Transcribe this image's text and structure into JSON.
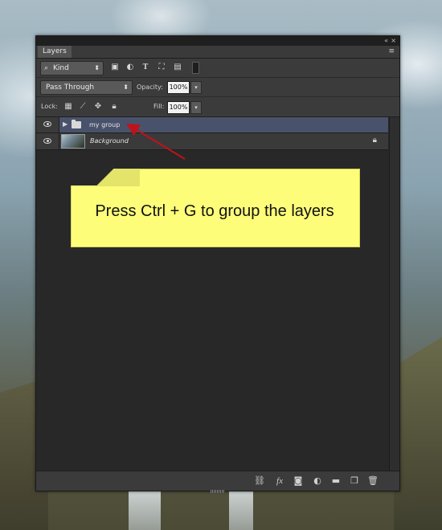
{
  "panel": {
    "title_tab": "Layers",
    "title_controls": {
      "collapse": "«",
      "close": "×"
    },
    "menu_icon": "≡"
  },
  "filter": {
    "kind_label": "Kind",
    "search_icon": "search-icon",
    "icons": [
      "image-filter-icon",
      "adjustment-filter-icon",
      "type-filter-icon",
      "shape-filter-icon",
      "smart-object-filter-icon",
      "filter-toggle-icon"
    ]
  },
  "blend": {
    "mode": "Pass Through",
    "opacity_label": "Opacity:",
    "opacity_value": "100%"
  },
  "lock": {
    "label": "Lock:",
    "icons": [
      "lock-transparent-icon",
      "lock-image-icon",
      "lock-position-icon",
      "lock-all-icon"
    ],
    "fill_label": "Fill:",
    "fill_value": "100%"
  },
  "layers": [
    {
      "name": "my group",
      "type": "group",
      "visible": true,
      "selected": true
    },
    {
      "name": "Background",
      "type": "image",
      "visible": true,
      "locked": true
    }
  ],
  "annotation": {
    "text": "Press Ctrl + G to group the layers",
    "color": "#fdfd7a",
    "arrow_color": "#c0121a"
  },
  "bottom_bar": {
    "icons": [
      "link-icon",
      "fx-icon",
      "mask-icon",
      "adjustment-icon",
      "new-group-icon",
      "new-layer-icon",
      "trash-icon"
    ],
    "fx_label": "fx"
  }
}
